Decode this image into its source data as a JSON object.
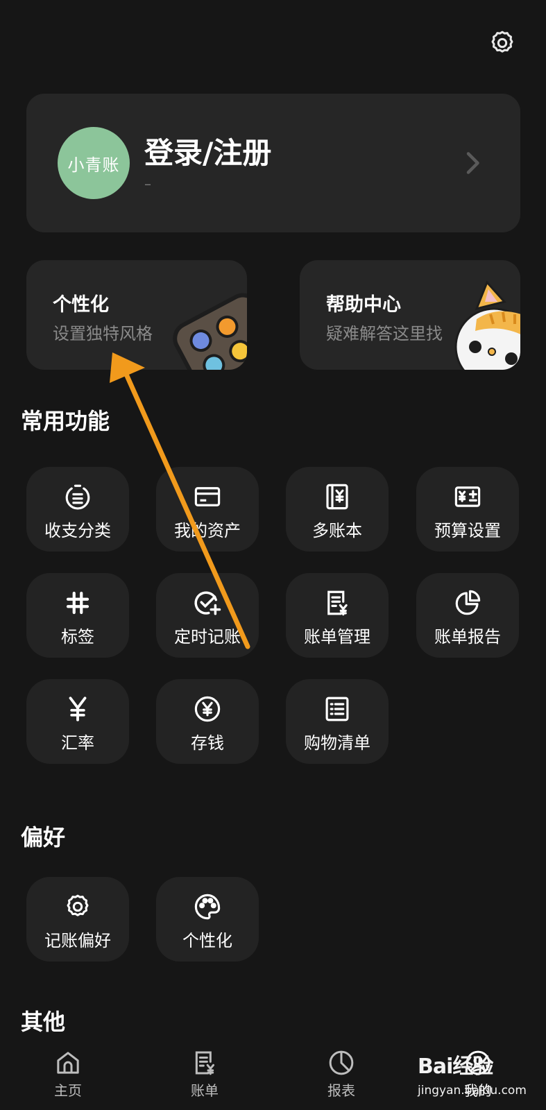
{
  "header": {
    "settings_icon": "gear-icon"
  },
  "profile": {
    "avatar_text": "小青账",
    "title": "登录/注册",
    "subtitle": "–",
    "avatar_color": "#8cc59a"
  },
  "promos": [
    {
      "title": "个性化",
      "subtitle": "设置独特风格"
    },
    {
      "title": "帮助中心",
      "subtitle": "疑难解答这里找"
    }
  ],
  "sections": {
    "common": "常用功能",
    "preferences": "偏好",
    "other": "其他"
  },
  "common_items": [
    {
      "label": "收支分类",
      "icon": "category-list-icon"
    },
    {
      "label": "我的资产",
      "icon": "card-icon"
    },
    {
      "label": "多账本",
      "icon": "ledger-book-icon"
    },
    {
      "label": "预算设置",
      "icon": "budget-calculator-icon"
    },
    {
      "label": "标签",
      "icon": "hashtag-icon"
    },
    {
      "label": "定时记账",
      "icon": "scheduled-check-icon"
    },
    {
      "label": "账单管理",
      "icon": "bill-manage-icon"
    },
    {
      "label": "账单报告",
      "icon": "pie-report-icon"
    },
    {
      "label": "汇率",
      "icon": "yen-icon"
    },
    {
      "label": "存钱",
      "icon": "coin-yen-icon"
    },
    {
      "label": "购物清单",
      "icon": "checklist-icon"
    }
  ],
  "preference_items": [
    {
      "label": "记账偏好",
      "icon": "gear-icon"
    },
    {
      "label": "个性化",
      "icon": "palette-icon"
    }
  ],
  "nav": [
    {
      "label": "主页",
      "icon": "home-icon"
    },
    {
      "label": "账单",
      "icon": "bill-icon"
    },
    {
      "label": "报表",
      "icon": "pie-chart-icon"
    },
    {
      "label": "我的",
      "icon": "profile-icon",
      "active": true
    }
  ],
  "watermark": {
    "brand": "Bai经验",
    "url": "jingyan.baidu.com"
  },
  "colors": {
    "background": "#161616",
    "card": "#262626",
    "tile": "#232323",
    "arrow": "#f19a1c"
  }
}
